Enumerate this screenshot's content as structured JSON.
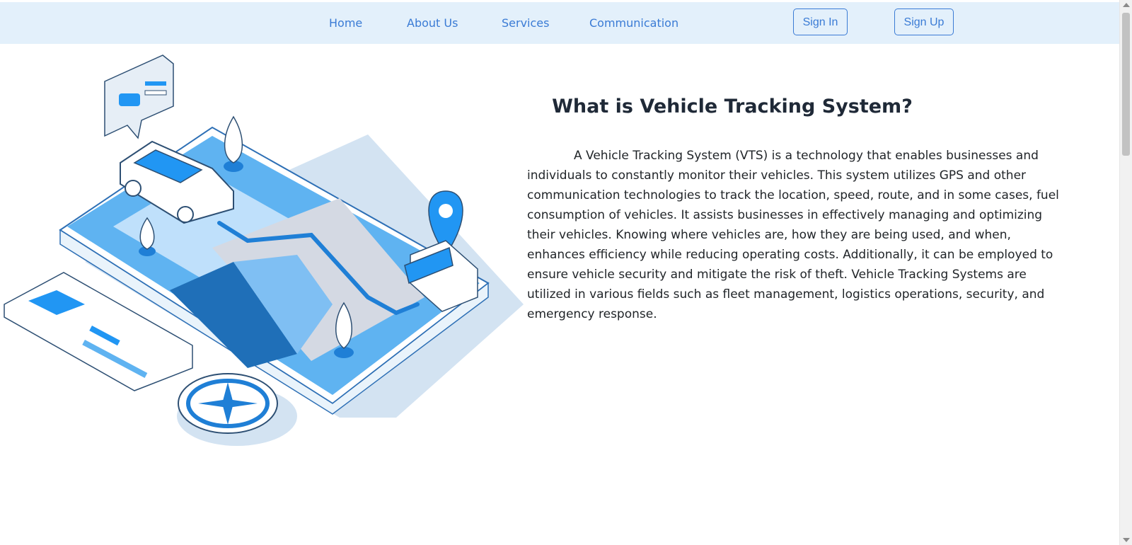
{
  "nav": {
    "links": [
      "Home",
      "About Us",
      "Services",
      "Communication"
    ],
    "sign_in": "Sign In",
    "sign_up": "Sign Up"
  },
  "hero": {
    "title": "What is Vehicle Tracking System?",
    "body": "A Vehicle Tracking System (VTS) is a technology that enables businesses and individuals to constantly monitor their vehicles. This system utilizes GPS and other communication technologies to track the location, speed, route, and in some cases, fuel consumption of vehicles. It assists businesses in effectively managing and optimizing their vehicles. Knowing where vehicles are, how they are being used, and when, enhances efficiency while reducing operating costs. Additionally, it can be employed to ensure vehicle security and mitigate the risk of theft. Vehicle Tracking Systems are utilized in various fields such as fleet management, logistics operations, security, and emergency response.",
    "illustration": "isometric-phone-map-car-illustration"
  },
  "colors": {
    "nav_bg": "#e3f0fb",
    "accent": "#3a7bd5",
    "illustration_blue": "#2196f3",
    "illustration_light": "#bfe0fb"
  }
}
